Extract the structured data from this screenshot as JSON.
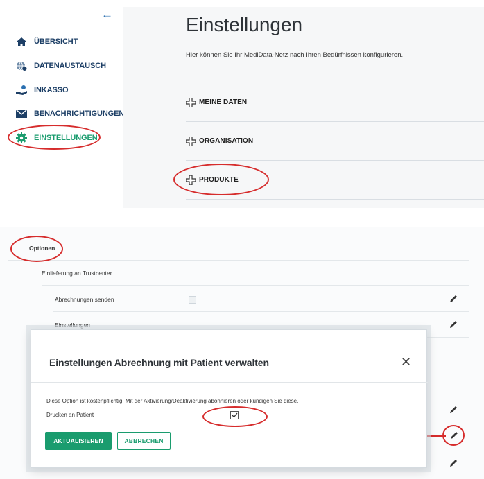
{
  "sidebar": {
    "back_icon": "arrow-left-icon",
    "items": [
      {
        "label": "ÜBERSICHT",
        "icon": "home-icon"
      },
      {
        "label": "DATENAUSTAUSCH",
        "icon": "globe-exchange-icon"
      },
      {
        "label": "INKASSO",
        "icon": "hand-coin-icon"
      },
      {
        "label": "BENACHRICHTIGUNGEN",
        "icon": "envelope-icon"
      },
      {
        "label": "EINSTELLUNGEN",
        "icon": "gear-icon",
        "active": true
      }
    ]
  },
  "main": {
    "title": "Einstellungen",
    "subtitle": "Hier können Sie Ihr MediData-Netz nach Ihren Bedürfnissen konfigurieren.",
    "sections": [
      {
        "label": "MEINE DATEN",
        "icon": "plus-cross-icon"
      },
      {
        "label": "ORGANISATION",
        "icon": "plus-cross-icon"
      },
      {
        "label": "PRODUKTE",
        "icon": "plus-cross-icon"
      }
    ]
  },
  "options": {
    "header": "Optionen",
    "group": "Einlieferung an Trustcenter",
    "rows": [
      {
        "label": "Abrechnungen senden"
      },
      {
        "label": "Einstellungen"
      }
    ]
  },
  "modal": {
    "title": "Einstellungen Abrechnung mit Patient verwalten",
    "close_icon": "close-icon",
    "description": "Diese Option ist kostenpflichtig. Mit der Aktivierung/Deaktivierung abonnieren oder kündigen Sie diese.",
    "field_label": "Drucken an Patient",
    "field_checked": true,
    "primary_button": "AKTUALISIEREN",
    "secondary_button": "ABBRECHEN"
  },
  "colors": {
    "accent_green": "#1a9c6e",
    "nav_blue": "#1d3f66",
    "annotation_red": "#d62c2c"
  }
}
